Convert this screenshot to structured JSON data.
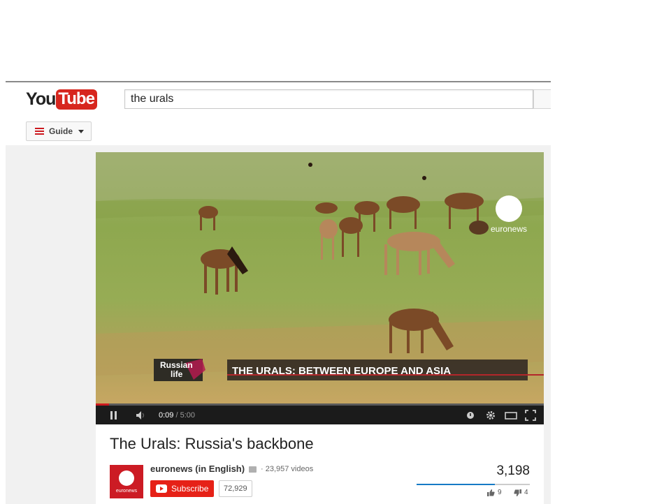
{
  "masthead": {
    "logo_you": "You",
    "logo_tube": "Tube",
    "search_value": "the urals"
  },
  "guide": {
    "label": "Guide"
  },
  "video": {
    "bug_text": "euronews",
    "lower_third_badge": [
      "Russian",
      "life"
    ],
    "lower_third_caption": "THE URALS: BETWEEN EUROPE AND ASIA"
  },
  "player": {
    "time_current": "0:09",
    "time_separator": "/",
    "time_total": "5:00",
    "progress": 0.03
  },
  "info": {
    "title": "The Urals: Russia's backbone",
    "channel_avatar_text": "euronews",
    "channel_name": "euronews (in English)",
    "video_count": "· 23,957 videos",
    "subscribe_label": "Subscribe",
    "subscriber_count": "72,929",
    "view_count": "3,198",
    "likes": "9",
    "dislikes": "4",
    "like_ratio": 0.69
  },
  "colors": {
    "brand_red": "#cc181e",
    "subscribe_red": "#e62117",
    "rating_blue": "#167ac6"
  },
  "icons": [
    "menu-icon",
    "play-pause-icon",
    "volume-icon",
    "annotations-icon",
    "settings-gear-icon",
    "theater-mode-icon",
    "fullscreen-icon",
    "thumbs-up-icon",
    "thumbs-down-icon"
  ]
}
